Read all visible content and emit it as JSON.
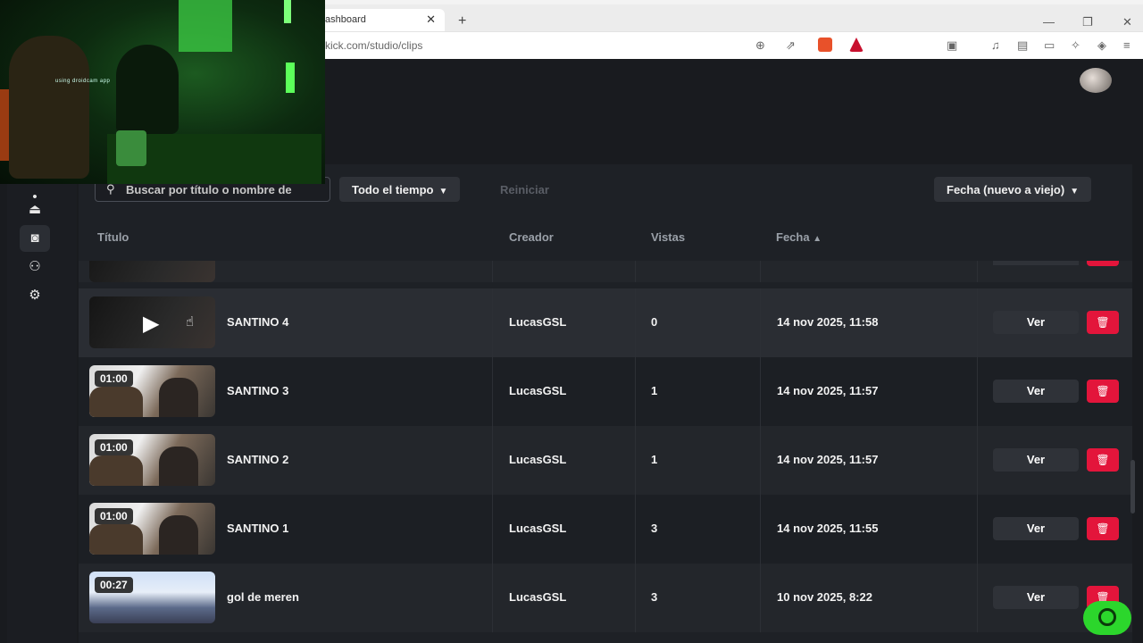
{
  "browser": {
    "tab_title": "ashboard",
    "tab_close": "✕",
    "new_tab": "+",
    "url": "kick.com/studio/clips",
    "win_min": "—",
    "win_max": "❐",
    "win_close": "✕"
  },
  "webcam": {
    "watermark": "using droidcam app"
  },
  "filters": {
    "search_placeholder": "Buscar por título o nombre de",
    "time_range": "Todo el tiempo",
    "reset": "Reiniciar",
    "sort": "Fecha (nuevo a viejo)"
  },
  "table": {
    "headers": {
      "title": "Título",
      "creator": "Creador",
      "views": "Vistas",
      "date": "Fecha"
    },
    "view_label": "Ver",
    "rows": [
      {
        "duration": "",
        "title": "SANTINO 4",
        "creator": "LucasGSL",
        "views": "0",
        "date": "14 nov 2025, 11:58"
      },
      {
        "duration": "01:00",
        "title": "SANTINO 3",
        "creator": "LucasGSL",
        "views": "1",
        "date": "14 nov 2025, 11:57"
      },
      {
        "duration": "01:00",
        "title": "SANTINO 2",
        "creator": "LucasGSL",
        "views": "1",
        "date": "14 nov 2025, 11:57"
      },
      {
        "duration": "01:00",
        "title": "SANTINO 1",
        "creator": "LucasGSL",
        "views": "3",
        "date": "14 nov 2025, 11:55"
      },
      {
        "duration": "00:27",
        "title": "gol de meren",
        "creator": "LucasGSL",
        "views": "3",
        "date": "10 nov 2025, 8:22"
      }
    ]
  },
  "icons": {
    "search": "search-icon",
    "chevron": "chevron-down-icon",
    "sort_asc": "chevron-up-icon",
    "delete": "trash-icon",
    "play": "play-icon",
    "chat": "chat-icon"
  },
  "colors": {
    "accent": "#2cd62c",
    "danger": "#e3153b",
    "background": "#191b1f"
  }
}
